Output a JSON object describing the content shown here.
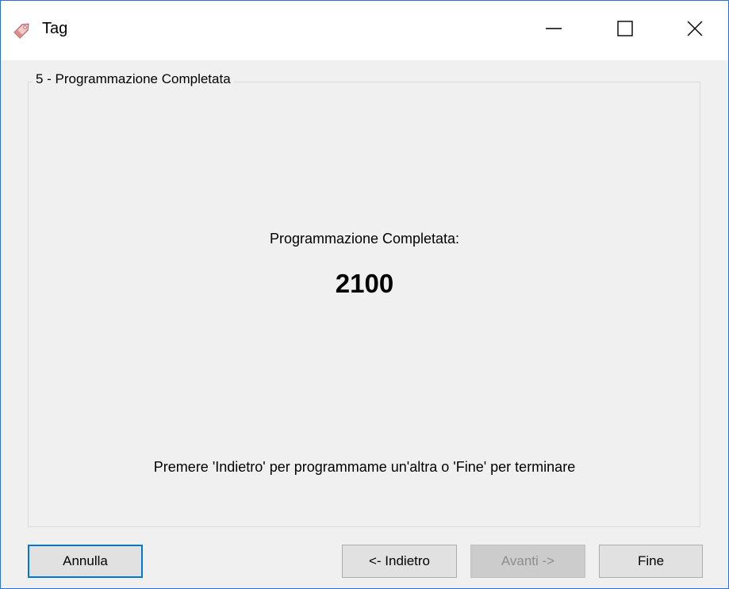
{
  "window": {
    "title": "Tag",
    "icon": "tag-icon",
    "controls": {
      "minimize": "minimize-icon",
      "maximize": "maximize-icon",
      "close": "close-icon"
    }
  },
  "step": {
    "group_title": "5 - Programmazione Completata",
    "completed_label": "Programmazione Completata:",
    "count_value": "2100",
    "instruction": "Premere 'Indietro' per programmame un'altra o 'Fine' per terminare"
  },
  "buttons": {
    "cancel": "Annulla",
    "back": "<- Indietro",
    "next": "Avanti ->",
    "finish": "Fine"
  },
  "colors": {
    "window_border": "#2a6fd6",
    "focus_border": "#0078d7",
    "disabled_text": "#8d8d8d"
  }
}
